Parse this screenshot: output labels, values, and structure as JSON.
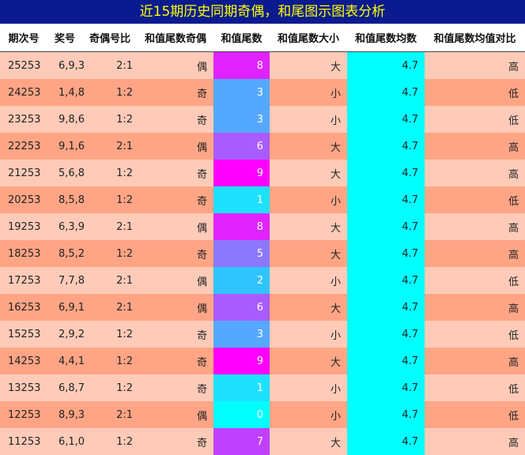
{
  "title": "近15期历史同期奇偶，和尾图示图表分析",
  "headers": [
    "期次号",
    "奖号",
    "奇偶号比",
    "和值尾数奇偶",
    "和值尾数",
    "和值尾数大小",
    "和值尾数均数",
    "和值尾数均值对比"
  ],
  "colors": {
    "title_bg": "#0b1b8f",
    "title_text": "#ffff00",
    "row_light": "#ffcbb8",
    "row_dark": "#ffa585",
    "avg_bg": "#00ffff",
    "tail": {
      "0": "#00ffff",
      "1": "#1ee0ff",
      "2": "#30c4ff",
      "3": "#55a8ff",
      "5": "#8c78ff",
      "6": "#a85cff",
      "7": "#c040ff",
      "8": "#e023ff",
      "9": "#ff00ff"
    }
  },
  "rows": [
    {
      "issue": "25253",
      "numbers": "6,9,3",
      "ratio": "2:1",
      "parity": "偶",
      "tail": "8",
      "size": "大",
      "avg": "4.7",
      "compare": "高"
    },
    {
      "issue": "24253",
      "numbers": "1,4,8",
      "ratio": "1:2",
      "parity": "奇",
      "tail": "3",
      "size": "小",
      "avg": "4.7",
      "compare": "低"
    },
    {
      "issue": "23253",
      "numbers": "9,8,6",
      "ratio": "1:2",
      "parity": "奇",
      "tail": "3",
      "size": "小",
      "avg": "4.7",
      "compare": "低"
    },
    {
      "issue": "22253",
      "numbers": "9,1,6",
      "ratio": "2:1",
      "parity": "偶",
      "tail": "6",
      "size": "大",
      "avg": "4.7",
      "compare": "高"
    },
    {
      "issue": "21253",
      "numbers": "5,6,8",
      "ratio": "1:2",
      "parity": "奇",
      "tail": "9",
      "size": "大",
      "avg": "4.7",
      "compare": "高"
    },
    {
      "issue": "20253",
      "numbers": "8,5,8",
      "ratio": "1:2",
      "parity": "奇",
      "tail": "1",
      "size": "小",
      "avg": "4.7",
      "compare": "低"
    },
    {
      "issue": "19253",
      "numbers": "6,3,9",
      "ratio": "2:1",
      "parity": "偶",
      "tail": "8",
      "size": "大",
      "avg": "4.7",
      "compare": "高"
    },
    {
      "issue": "18253",
      "numbers": "8,5,2",
      "ratio": "1:2",
      "parity": "奇",
      "tail": "5",
      "size": "大",
      "avg": "4.7",
      "compare": "高"
    },
    {
      "issue": "17253",
      "numbers": "7,7,8",
      "ratio": "2:1",
      "parity": "偶",
      "tail": "2",
      "size": "小",
      "avg": "4.7",
      "compare": "低"
    },
    {
      "issue": "16253",
      "numbers": "6,9,1",
      "ratio": "2:1",
      "parity": "偶",
      "tail": "6",
      "size": "大",
      "avg": "4.7",
      "compare": "高"
    },
    {
      "issue": "15253",
      "numbers": "2,9,2",
      "ratio": "1:2",
      "parity": "奇",
      "tail": "3",
      "size": "小",
      "avg": "4.7",
      "compare": "低"
    },
    {
      "issue": "14253",
      "numbers": "4,4,1",
      "ratio": "1:2",
      "parity": "奇",
      "tail": "9",
      "size": "大",
      "avg": "4.7",
      "compare": "高"
    },
    {
      "issue": "13253",
      "numbers": "6,8,7",
      "ratio": "1:2",
      "parity": "奇",
      "tail": "1",
      "size": "小",
      "avg": "4.7",
      "compare": "低"
    },
    {
      "issue": "12253",
      "numbers": "8,9,3",
      "ratio": "2:1",
      "parity": "偶",
      "tail": "0",
      "size": "小",
      "avg": "4.7",
      "compare": "低"
    },
    {
      "issue": "11253",
      "numbers": "6,1,0",
      "ratio": "1:2",
      "parity": "奇",
      "tail": "7",
      "size": "大",
      "avg": "4.7",
      "compare": "高"
    }
  ]
}
